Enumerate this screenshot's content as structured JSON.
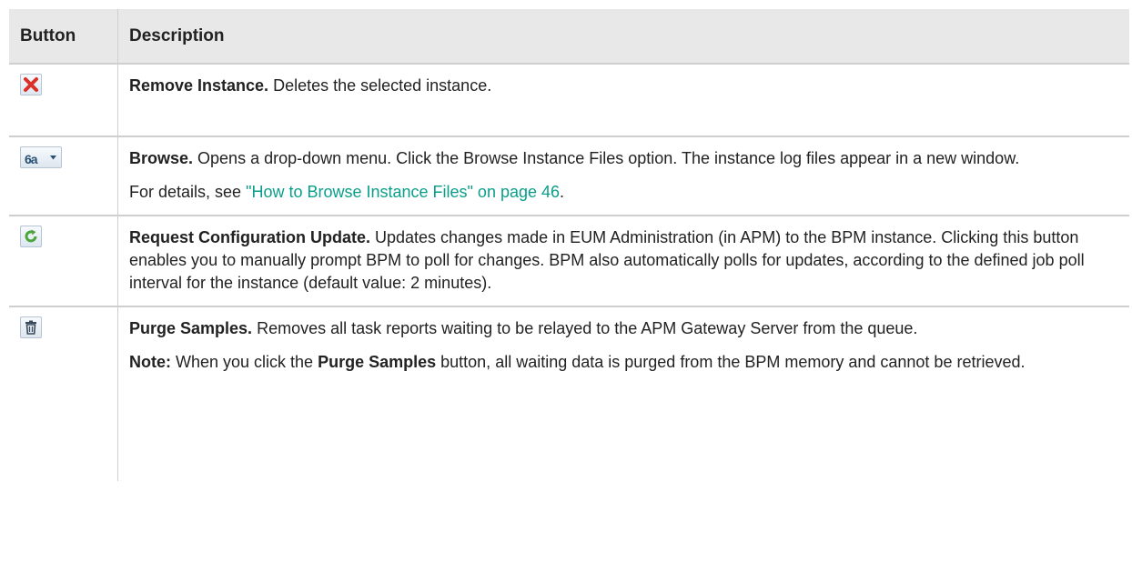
{
  "table": {
    "headers": {
      "button": "Button",
      "description": "Description"
    },
    "rows": [
      {
        "icon": "remove-x-icon",
        "title": "Remove Instance.",
        "text": " Deletes the selected instance."
      },
      {
        "icon": "browse-glasses-dropdown-icon",
        "icon_glyph": "6a",
        "title": "Browse.",
        "text": " Opens a drop-down menu. Click the Browse Instance Files option. The instance log files appear in a new window.",
        "details_prefix": "For details, see ",
        "details_link": "\"How to Browse Instance Files\" on page 46",
        "details_suffix": "."
      },
      {
        "icon": "refresh-arrow-icon",
        "title": "Request Configuration Update.",
        "text": " Updates changes made in EUM Administration (in APM) to the BPM instance. Clicking this button enables you to manually prompt BPM to poll for changes. BPM also automatically polls for updates, according to the defined job poll interval for the instance (default value: 2 minutes)."
      },
      {
        "icon": "trash-can-icon",
        "title": "Purge Samples.",
        "text": " Removes all task reports waiting to be relayed to the APM Gateway Server from the queue.",
        "note_label": "Note:",
        "note_pre": " When you click the ",
        "note_bold": "Purge Samples",
        "note_post": " button, all waiting data is purged from the BPM memory and cannot be retrieved."
      }
    ]
  },
  "colors": {
    "header_bg": "#e8e8e8",
    "border": "#cfcfcf",
    "link": "#0a9e8a",
    "remove_red": "#d9312a",
    "refresh_green": "#4ca53c"
  }
}
